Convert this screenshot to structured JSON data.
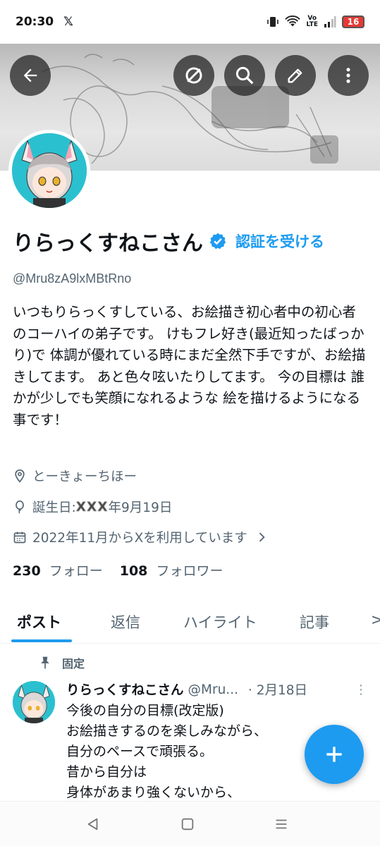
{
  "status": {
    "time": "20:30",
    "x_logo": "𝕏",
    "volte": "Vo\nLTE",
    "battery": "16"
  },
  "header": {
    "back_icon": "arrow-left-icon",
    "grok_icon": "slash-circle-icon",
    "search_icon": "search-icon",
    "edit_icon": "pencil-icon",
    "more_icon": "more-vertical-icon"
  },
  "profile": {
    "display_name": "りらっくすねこさん",
    "get_verified": "認証を受ける",
    "handle": "@Mru8zA9lxMBtRno",
    "bio": "いつもりらっくすしている、お絵描き初心者中の初心者のコーハイの弟子です。 けもフレ好き(最近知ったばっかり)で 体調が優れている時にまだ全然下手ですが、お絵描きしてます。 あと色々呟いたりしてます。 今の目標は 誰かが少しでも笑顔になれるような 絵を描けるようになる事です！",
    "location": "とーきょーちほー",
    "birthday_prefix": "誕生日: ",
    "birthday_year": "XXX",
    "birthday_suffix": "年9月19日",
    "joined": "2022年11月からXを利用しています",
    "following_count": "230",
    "following_label": "フォロー",
    "followers_count": "108",
    "followers_label": "フォロワー"
  },
  "tabs": [
    {
      "label": "ポスト"
    },
    {
      "label": "返信"
    },
    {
      "label": "ハイライト"
    },
    {
      "label": "記事"
    },
    {
      "label": ">"
    }
  ],
  "pinned": {
    "label": "固定"
  },
  "tweet": {
    "name": "りらっくすねこさん",
    "handle": "@Mru...",
    "date": "· 2月18日",
    "more": "⋮",
    "lines": [
      "今後の自分の目標(改定版)",
      "お絵描きするのを楽しみながら、",
      "自分のペースで頑張る。",
      "昔から自分は",
      "身体があまり強くないから、"
    ]
  },
  "colors": {
    "accent": "#1d9bf0",
    "text": "#0f1419",
    "secondary": "#536471"
  }
}
